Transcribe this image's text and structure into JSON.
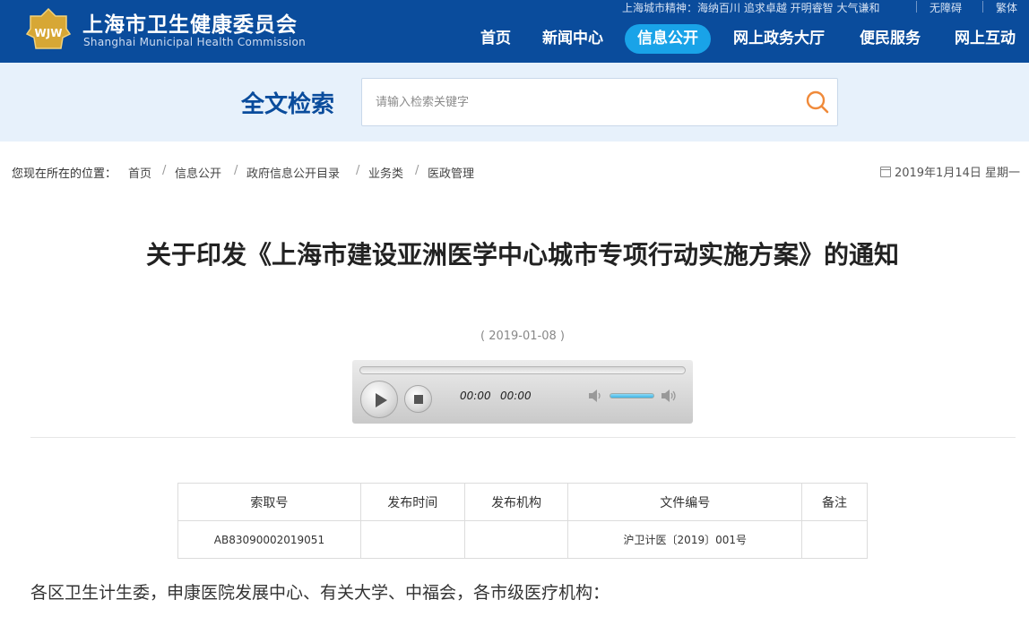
{
  "header": {
    "brand_cn": "上海市卫生健康委员会",
    "brand_en": "Shanghai Municipal Health Commission",
    "logo_text": "WJW",
    "slogan": "上海城市精神：海纳百川 追求卓越 开明睿智 大气谦和",
    "accessibility": "无障碍",
    "traditional": "繁体",
    "nav": [
      {
        "label": "首页"
      },
      {
        "label": "新闻中心"
      },
      {
        "label": "信息公开",
        "active": true
      },
      {
        "label": "网上政务大厅"
      },
      {
        "label": "便民服务"
      },
      {
        "label": "网上互动"
      }
    ],
    "colors": {
      "bar": "#0a4c9c",
      "active": "#19a3e8"
    }
  },
  "search": {
    "title": "全文检索",
    "placeholder": "请输入检索关键字",
    "icon": "search-icon",
    "accent": "#f08a3a"
  },
  "breadcrumb": {
    "lead": "您现在所在的位置：",
    "items": [
      "首页",
      "信息公开",
      "政府信息公开目录",
      "业务类",
      "医政管理"
    ],
    "separator": "/",
    "date": "2019年1月14日 星期一"
  },
  "article": {
    "title": "关于印发《上海市建设亚洲医学中心城市专项行动实施方案》的通知",
    "date": "( 2019-01-08 )",
    "body_intro": "各区卫生计生委，申康医院发展中心、有关大学、中福会，各市级医疗机构："
  },
  "player": {
    "current_time": "00:00",
    "duration": "00:00",
    "progress": 0,
    "volume": 0.8
  },
  "table": {
    "headers": [
      "索取号",
      "发布时间",
      "发布机构",
      "文件编号",
      "备注"
    ],
    "rows": [
      [
        "AB83090002019051",
        "",
        "",
        "沪卫计医〔2019〕001号",
        ""
      ]
    ]
  }
}
